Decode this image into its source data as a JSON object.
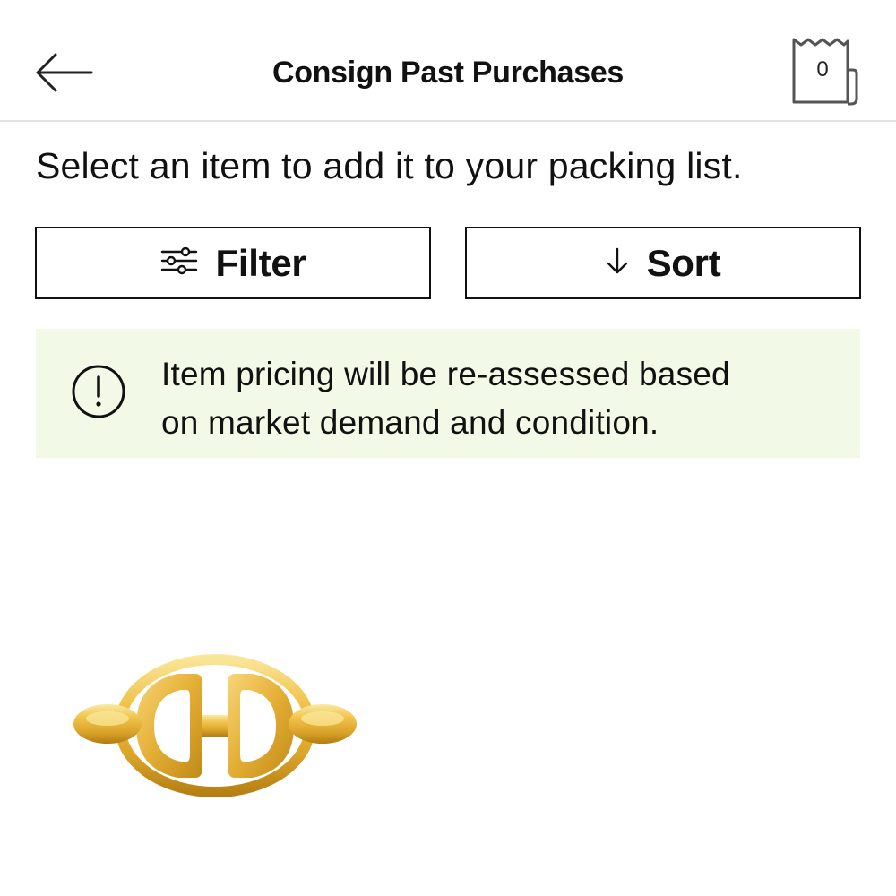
{
  "header": {
    "title": "Consign Past Purchases",
    "back_icon": "arrow-left-icon",
    "bag_icon": "shopping-bag-icon",
    "bag_count": "0"
  },
  "instruction": "Select an item to add it to your packing list.",
  "controls": {
    "filter_label": "Filter",
    "filter_icon": "sliders-icon",
    "sort_label": "Sort",
    "sort_icon": "arrow-down-icon"
  },
  "notice": {
    "icon": "exclamation-circle-icon",
    "line1": "Item pricing will be re-assessed based",
    "line2": "on market demand and condition."
  },
  "products": [
    {
      "image_icon": "gold-chaine-d-ancre-ring-image"
    }
  ],
  "colors": {
    "notice_background": "#f2f9e6",
    "text": "#111111",
    "divider": "#e2e2e2",
    "gold": "#e8b536"
  }
}
